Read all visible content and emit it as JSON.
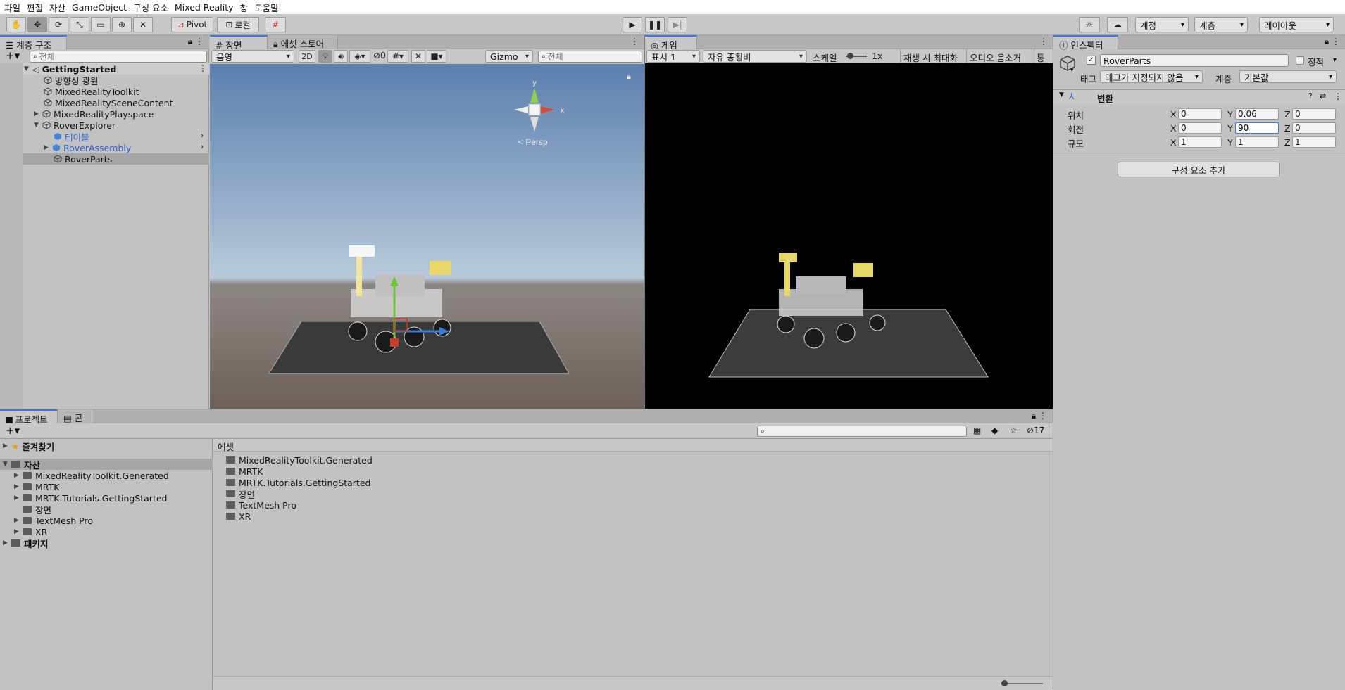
{
  "menu": [
    "파일",
    "편집",
    "자산",
    "GameObject",
    "구성 요소",
    "Mixed Reality",
    "창",
    "도움말"
  ],
  "toolbar": {
    "pivot_label": "Pivot",
    "local_label": "로컬",
    "account_label": "계정",
    "layers_label": "계층",
    "layout_label": "레이아웃"
  },
  "hierarchy": {
    "tab_label": "계층 구조",
    "search_placeholder": "전체",
    "scene_name": "GettingStarted",
    "items": [
      "방향성 광원",
      "MixedRealityToolkit",
      "MixedRealitySceneContent",
      "MixedRealityPlayspace",
      "RoverExplorer",
      "테이블",
      "RoverAssembly",
      "RoverParts"
    ]
  },
  "scene": {
    "tab_label": "장면",
    "asset_store_tab": "에셋 스토어",
    "shading": "음영",
    "mode_2d": "2D",
    "hidden_count": "0",
    "gizmo_label": "Gizmo",
    "search_placeholder": "전체",
    "persp_label": "Persp",
    "gizmo_axes": {
      "x": "x",
      "y": "y"
    }
  },
  "game": {
    "tab_label": "게임",
    "display": "표시 1",
    "aspect": "자유 종횡비",
    "scale_label": "스케일",
    "scale_value": "1x",
    "maximize_label": "재생 시 최대화",
    "mute_label": "오디오 음소거",
    "stats_label": "통계"
  },
  "inspector": {
    "tab_label": "인스펙터",
    "object_name": "RoverParts",
    "static_label": "정적",
    "tag_label": "태그",
    "tag_value": "태그가 지정되지 않음",
    "layer_label": "계층",
    "layer_value": "기본값",
    "transform_label": "변환",
    "position_label": "위치",
    "rotation_label": "회전",
    "scale_label": "규모",
    "axes": [
      "X",
      "Y",
      "Z"
    ],
    "position": [
      "0",
      "0.06",
      "0"
    ],
    "rotation": [
      "0",
      "90",
      "0"
    ],
    "scale": [
      "1",
      "1",
      "1"
    ],
    "add_component": "구성 요소 추가"
  },
  "project": {
    "tab_label": "프로젝트",
    "console_tab": "콘솔",
    "hidden_count": "17",
    "favorites": "즐겨찾기",
    "assets": "자산",
    "tree": [
      "MixedRealityToolkit.Generated",
      "MRTK",
      "MRTK.Tutorials.GettingStarted",
      "장면",
      "TextMesh Pro",
      "XR"
    ],
    "packages": "패키지",
    "breadcrumb": "에셋",
    "folders": [
      "MixedRealityToolkit.Generated",
      "MRTK",
      "MRTK.Tutorials.GettingStarted",
      "장면",
      "TextMesh Pro",
      "XR"
    ]
  },
  "colors": {
    "accent": "#3a79d8",
    "link": "#2a62c9",
    "selection": "#a6a6a6"
  }
}
